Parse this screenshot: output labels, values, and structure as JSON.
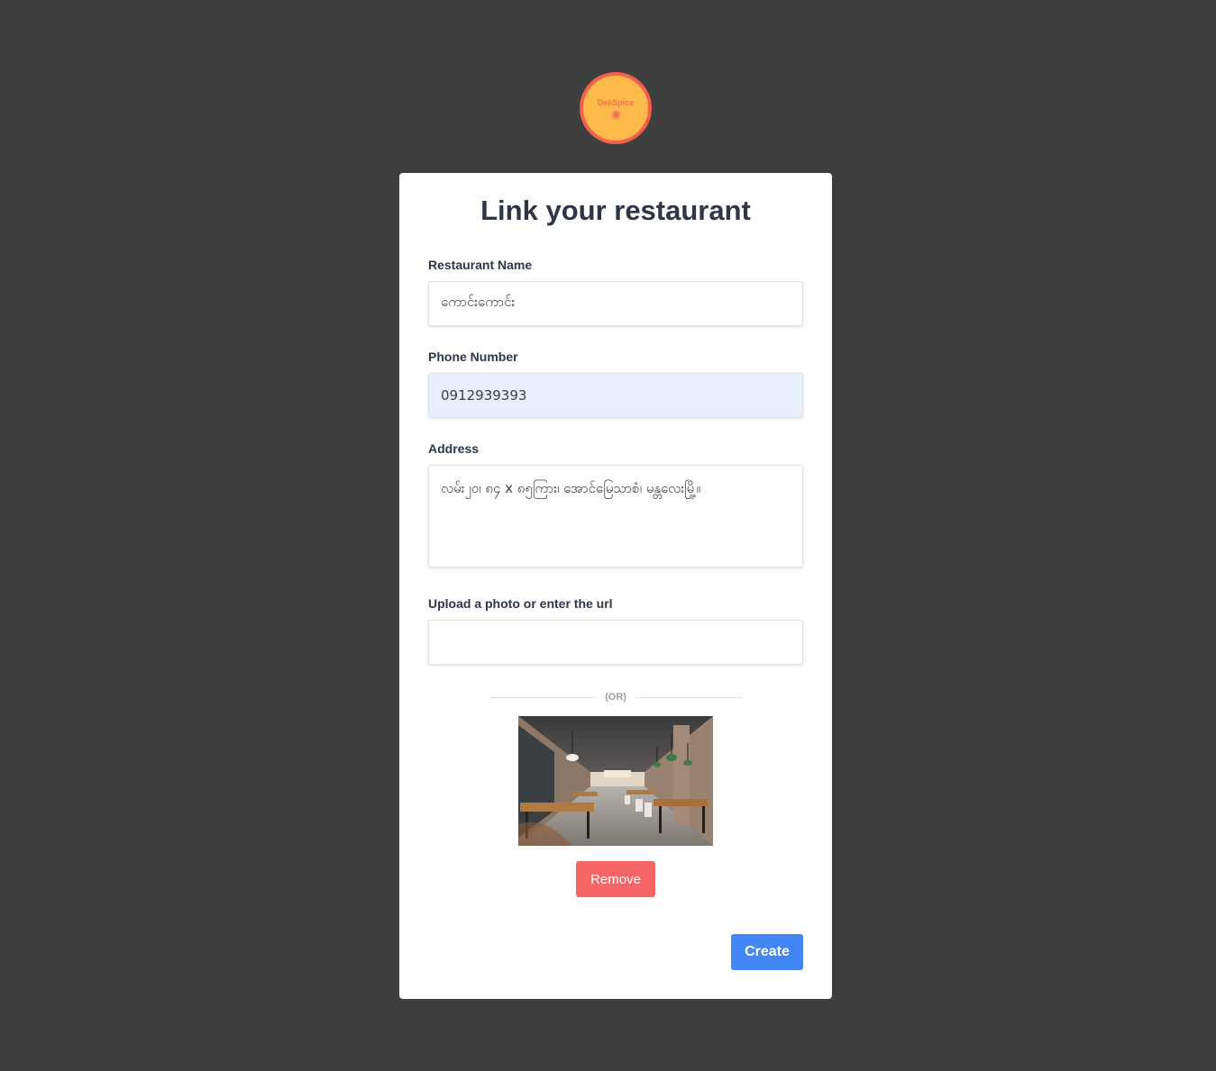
{
  "brand": {
    "logo_text": "DeliSpice"
  },
  "form": {
    "title": "Link your restaurant",
    "restaurant_name": {
      "label": "Restaurant Name",
      "value": "ကောင်းကောင်း"
    },
    "phone": {
      "label": "Phone Number",
      "value": "0912939393"
    },
    "address": {
      "label": "Address",
      "value": "လမ်း၂၀၊ ၈၄ x ၈၅ကြား၊ အောင်မြေသာစံ၊ မန္တလေးမြို့။"
    },
    "photo": {
      "label": "Upload a photo or enter the url",
      "value": ""
    },
    "or_text": "(OR)",
    "remove_label": "Remove",
    "create_label": "Create"
  },
  "colors": {
    "background": "#3f3f3f",
    "remove": "#f56565",
    "create": "#4286f4",
    "logo_fill": "#fdb94a",
    "logo_ring": "#f5604d"
  }
}
